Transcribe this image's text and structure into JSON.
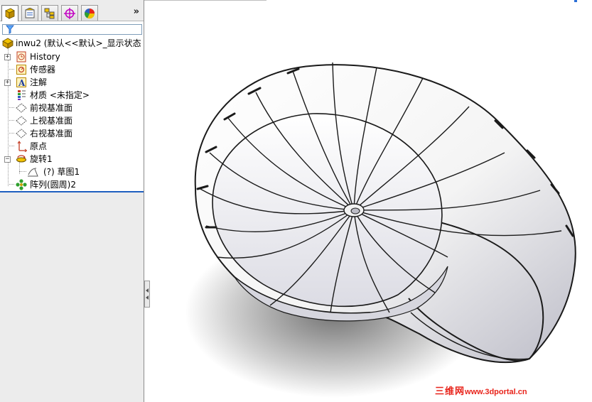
{
  "panel": {
    "tabs": [
      {
        "name": "featuremanager-tab",
        "icon": "featuremanager-icon",
        "active": true
      },
      {
        "name": "propertymanager-tab",
        "icon": "propertymanager-icon",
        "active": false
      },
      {
        "name": "configurationmanager-tab",
        "icon": "configurationmanager-icon",
        "active": false
      },
      {
        "name": "dimxpert-tab",
        "icon": "dimxpert-icon",
        "active": false
      },
      {
        "name": "displaymanager-tab",
        "icon": "displaymanager-icon",
        "active": false
      }
    ],
    "more_tabs": "»",
    "filter_icon": "filter-icon"
  },
  "tree": {
    "root": {
      "label": "inwu2  (默认<<默认>_显示状态",
      "icon": "part-icon"
    },
    "items": [
      {
        "label": "History",
        "icon": "history-icon",
        "expandable": true
      },
      {
        "label": "传感器",
        "icon": "sensor-icon",
        "expandable": false
      },
      {
        "label": "注解",
        "icon": "annotation-icon",
        "expandable": true
      },
      {
        "label": "材质 <未指定>",
        "icon": "material-icon",
        "expandable": false
      },
      {
        "label": "前视基准面",
        "icon": "plane-icon",
        "expandable": false
      },
      {
        "label": "上视基准面",
        "icon": "plane-icon",
        "expandable": false
      },
      {
        "label": "右视基准面",
        "icon": "plane-icon",
        "expandable": false
      },
      {
        "label": "原点",
        "icon": "origin-icon",
        "expandable": false
      },
      {
        "label": "旋转1",
        "icon": "revolve-icon",
        "expandable": true,
        "expanded": true
      },
      {
        "label": "(?) 草图1",
        "icon": "sketch-icon",
        "child": true
      },
      {
        "label": "阵列(圆周)2",
        "icon": "circular-pattern-icon",
        "expandable": false
      }
    ]
  },
  "watermark": {
    "brand": "三维网",
    "url": "www.3dportal.cn",
    "color": "#e8231a"
  },
  "colors": {
    "selection": "#1f5fbf",
    "panel_bg": "#ececec"
  }
}
